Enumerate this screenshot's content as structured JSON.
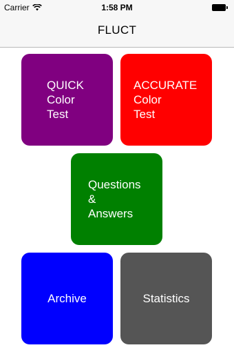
{
  "status_bar": {
    "carrier": "Carrier",
    "time": "1:58 PM",
    "wifi_icon": "wifi-icon",
    "battery_icon": "battery-icon"
  },
  "nav": {
    "title": "FLUCT"
  },
  "tiles": [
    {
      "lines": [
        "QUICK",
        "Color",
        "Test"
      ],
      "color": "#800080"
    },
    {
      "lines": [
        "ACCURATE",
        "Color",
        "Test"
      ],
      "color": "#ff0000"
    },
    {
      "lines": [
        "Questions",
        "&",
        "Answers"
      ],
      "color": "#008000"
    },
    {
      "lines": [
        "Archive"
      ],
      "color": "#0000ff"
    },
    {
      "lines": [
        "Statistics"
      ],
      "color": "#555555"
    }
  ]
}
